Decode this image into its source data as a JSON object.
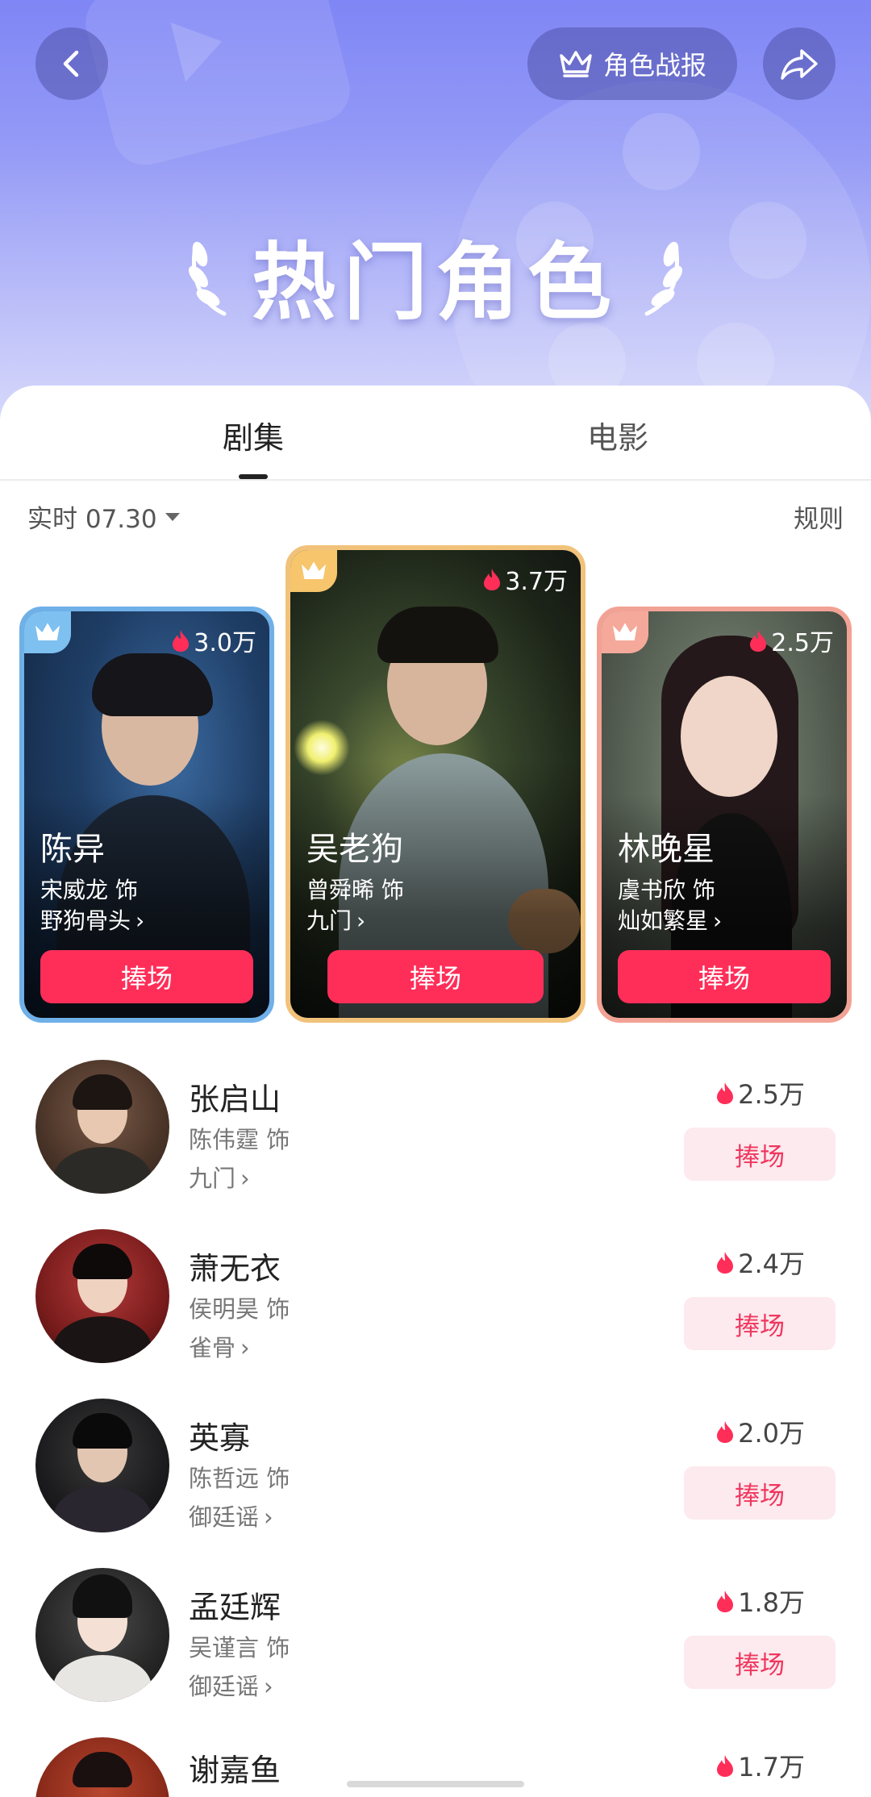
{
  "header": {
    "report_label": "角色战报",
    "title": "热门角色"
  },
  "tabs": [
    {
      "label": "剧集",
      "active": true
    },
    {
      "label": "电影",
      "active": false
    }
  ],
  "filter": {
    "date_label": "实时 07.30",
    "rules_label": "规则"
  },
  "top3": [
    {
      "rank": 2,
      "role": "陈异",
      "actor": "宋威龙 饰",
      "show": "野狗骨头",
      "heat": "3.0万",
      "button": "捧场"
    },
    {
      "rank": 1,
      "role": "吴老狗",
      "actor": "曾舜晞 饰",
      "show": "九门",
      "heat": "3.7万",
      "button": "捧场"
    },
    {
      "rank": 3,
      "role": "林晚星",
      "actor": "虞书欣 饰",
      "show": "灿如繁星",
      "heat": "2.5万",
      "button": "捧场"
    }
  ],
  "list": [
    {
      "role": "张启山",
      "actor": "陈伟霆 饰",
      "show": "九门",
      "heat": "2.5万",
      "button": "捧场"
    },
    {
      "role": "萧无衣",
      "actor": "侯明昊 饰",
      "show": "雀骨",
      "heat": "2.4万",
      "button": "捧场"
    },
    {
      "role": "英寡",
      "actor": "陈哲远 饰",
      "show": "御廷谣",
      "heat": "2.0万",
      "button": "捧场"
    },
    {
      "role": "孟廷辉",
      "actor": "吴谨言 饰",
      "show": "御廷谣",
      "heat": "1.8万",
      "button": "捧场"
    },
    {
      "role": "谢嘉鱼",
      "heat": "1.7万"
    }
  ],
  "colors": {
    "accent": "#ff2e59",
    "rank1_border": "#f1c27a",
    "rank2_border": "#6fb0e8",
    "rank3_border": "#f2a294"
  }
}
